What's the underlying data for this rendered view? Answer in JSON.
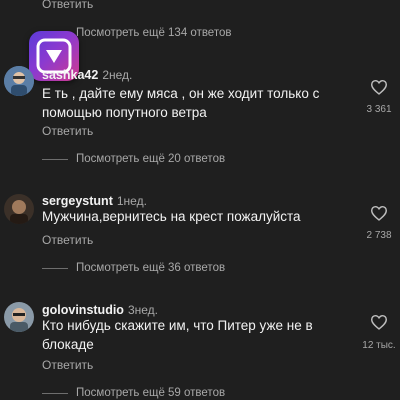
{
  "top": {
    "reply_label": "Ответить",
    "view_more_label": "Посмотреть ещё 134 ответов"
  },
  "app_icon": {
    "name": "play-app-icon",
    "colors": [
      "#5b3bd8",
      "#d23a8e"
    ]
  },
  "comments": [
    {
      "username": "sashka42",
      "time": "2нед.",
      "text_line1": "Е  ть , дайте ему мяса , он же ходит только с",
      "text_line2": "помощью попутного ветра",
      "reply_label": "Ответить",
      "likes": "3 361",
      "view_more_label": "Посмотреть ещё 20 ответов"
    },
    {
      "username": "sergeystunt",
      "time": "1нед.",
      "text_line1": "Мужчина,вернитесь на крест пожалуйста",
      "reply_label": "Ответить",
      "likes": "2 738",
      "view_more_label": "Посмотреть ещё 36 ответов"
    },
    {
      "username": "golovinstudio",
      "time": "3нед.",
      "text_line1": "Кто нибудь скажите им, что Питер уже не в",
      "text_line2": "блокаде",
      "reply_label": "Ответить",
      "likes": "12 тыс.",
      "view_more_label": "Посмотреть ещё 59 ответов"
    }
  ],
  "icons": {
    "like": "heart-outline-icon"
  }
}
